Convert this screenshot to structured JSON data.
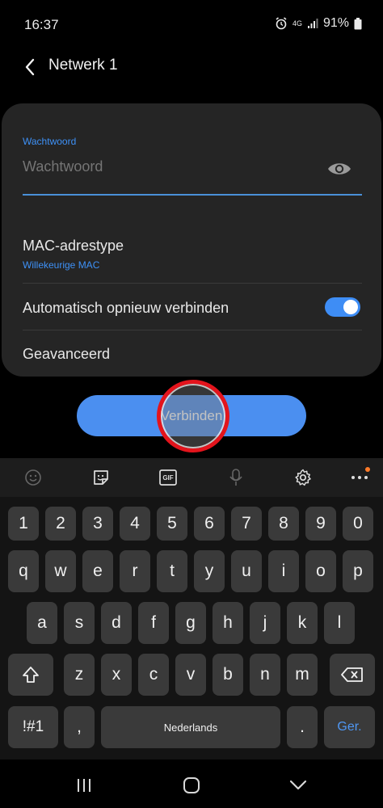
{
  "status": {
    "time": "16:37",
    "network": "4G",
    "battery": "91%"
  },
  "appbar": {
    "title": "Netwerk 1"
  },
  "password": {
    "label": "Wachtwoord",
    "placeholder": "Wachtwoord"
  },
  "mac": {
    "title": "MAC-adrestype",
    "value": "Willekeurige MAC"
  },
  "auto_reconnect": {
    "label": "Automatisch opnieuw verbinden",
    "enabled": true
  },
  "advanced": {
    "label": "Geavanceerd"
  },
  "connect": {
    "label": "Verbinden"
  },
  "keyboard": {
    "numbers": [
      "1",
      "2",
      "3",
      "4",
      "5",
      "6",
      "7",
      "8",
      "9",
      "0"
    ],
    "row1": [
      "q",
      "w",
      "e",
      "r",
      "t",
      "y",
      "u",
      "i",
      "o",
      "p"
    ],
    "row2": [
      "a",
      "s",
      "d",
      "f",
      "g",
      "h",
      "j",
      "k",
      "l"
    ],
    "row3": [
      "z",
      "x",
      "c",
      "v",
      "b",
      "n",
      "m"
    ],
    "symbols": "!#1",
    "comma": ",",
    "space": "Nederlands",
    "period": ".",
    "go": "Ger.",
    "gif_label": "GIF"
  },
  "colors": {
    "accent": "#3e91f7",
    "button": "#4b8ff0",
    "touch_ring": "#e3141c"
  }
}
